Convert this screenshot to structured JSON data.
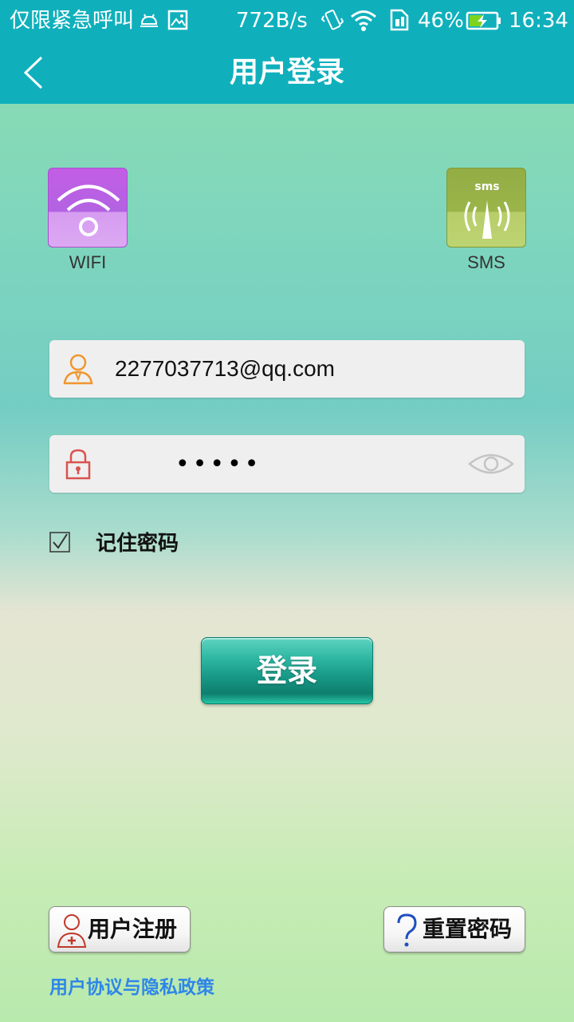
{
  "status_bar": {
    "carrier_text": "仅限紧急呼叫",
    "net_speed": "772B/s",
    "battery_percent": "46%",
    "time": "16:34",
    "icons": [
      "android-icon",
      "image-icon",
      "vibrate-icon",
      "wifi-signal-icon",
      "sim-icon",
      "battery-charging-icon"
    ]
  },
  "app_bar": {
    "title": "用户登录",
    "back_icon": "chevron-left-icon"
  },
  "modes": {
    "wifi": {
      "label": "WIFI",
      "icon": "wifi-icon",
      "color": "#b866e4"
    },
    "sms": {
      "label": "SMS",
      "icon": "sms-antenna-icon",
      "icon_text": "sms",
      "color": "#a3bb52"
    }
  },
  "form": {
    "username": {
      "value": "2277037713@qq.com",
      "icon": "user-icon"
    },
    "password": {
      "masked_value": "•••••",
      "icon": "lock-icon",
      "toggle_icon": "eye-icon"
    },
    "remember": {
      "label": "记住密码",
      "checked": true
    }
  },
  "login_button": {
    "label": "登录"
  },
  "footer": {
    "register_button": {
      "label": "用户注册",
      "icon": "user-add-icon"
    },
    "reset_button": {
      "label": "重置密码",
      "icon": "question-icon"
    },
    "policy_link": "用户协议与隐私政策"
  },
  "colors": {
    "primary": "#0fb0bc",
    "link": "#2f86e8",
    "login_button": "#179886"
  }
}
